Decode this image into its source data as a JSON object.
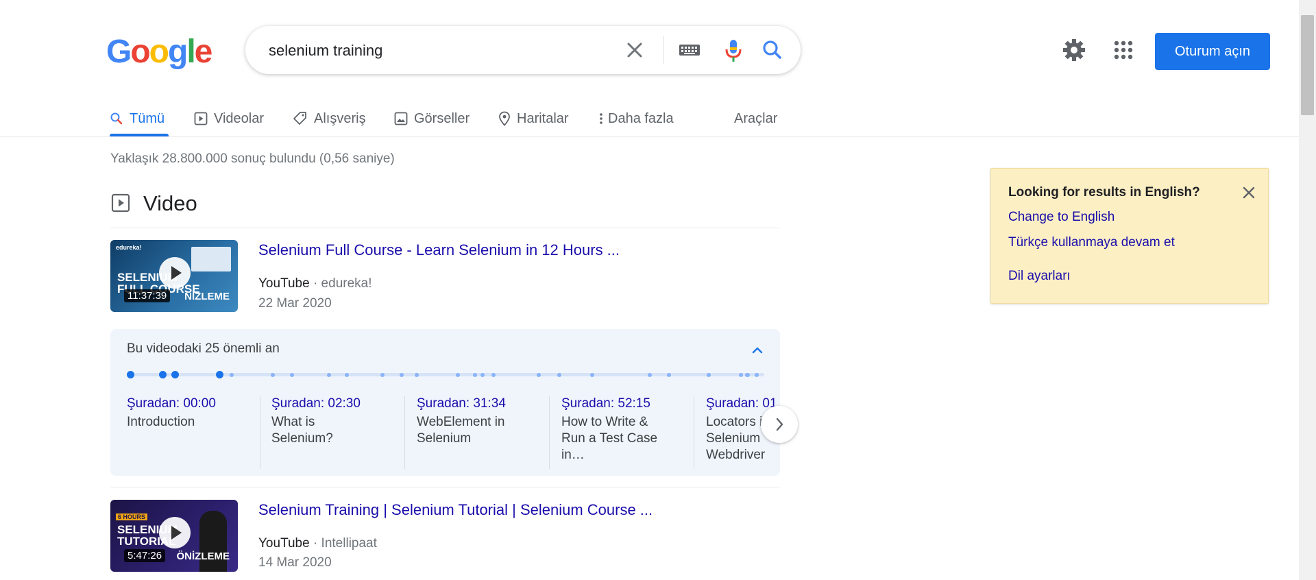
{
  "logo": {
    "letters": [
      "G",
      "o",
      "o",
      "g",
      "l",
      "e"
    ]
  },
  "search": {
    "query": "selenium training"
  },
  "header": {
    "signin_label": "Oturum açın"
  },
  "tabs": [
    {
      "label": "Tümü",
      "icon": "search-icon",
      "active": true
    },
    {
      "label": "Videolar",
      "icon": "video-icon"
    },
    {
      "label": "Alışveriş",
      "icon": "tag-icon"
    },
    {
      "label": "Görseller",
      "icon": "image-icon"
    },
    {
      "label": "Haritalar",
      "icon": "map-pin-icon"
    },
    {
      "label": "Daha fazla",
      "icon": "more-vert-icon"
    },
    {
      "label": "Araçlar"
    }
  ],
  "result_stats": "Yaklaşık 28.800.000 sonuç bulundu (0,56 saniye)",
  "video_section": {
    "heading": "Video"
  },
  "videos": [
    {
      "title": "Selenium Full Course - Learn Selenium in 12 Hours ...",
      "source": "YouTube",
      "channel": "· edureka!",
      "date": "22 Mar 2020",
      "duration": "11:37:39",
      "thumb_brand": "edureka!",
      "thumb_text": "SELENIUM\nFULL COURSE",
      "preview_label": "NİZLEME"
    },
    {
      "title": "Selenium Training | Selenium Tutorial | Selenium Course ...",
      "source": "YouTube",
      "channel": "· Intellipaat",
      "date": "14 Mar 2020",
      "duration": "5:47:26",
      "thumb_brand": "6 HOURS",
      "thumb_text": "SELENIUM\nTUTORIAL",
      "preview_label": "ÖNİZLEME"
    }
  ],
  "key_moments": {
    "title": "Bu videodaki 25 önemli an",
    "items": [
      {
        "time": "Şuradan: 00:00",
        "label": "Introduction"
      },
      {
        "time": "Şuradan: 02:30",
        "label": "What is Selenium?"
      },
      {
        "time": "Şuradan: 31:34",
        "label": "WebElement in Selenium"
      },
      {
        "time": "Şuradan: 52:15",
        "label": "How to Write & Run a Test Case in…"
      },
      {
        "time": "Şuradan: 01",
        "label": "Locators in Selenium Webdriver"
      }
    ]
  },
  "language_card": {
    "title": "Looking for results in English?",
    "change_link": "Change to English",
    "keep_link": "Türkçe kullanmaya devam et",
    "settings_link": "Dil ayarları"
  },
  "colors": {
    "accent": "#1a73e8",
    "link": "#1a0dab",
    "card_bg": "#fcefc4",
    "moments_bg": "#f0f5fc"
  }
}
